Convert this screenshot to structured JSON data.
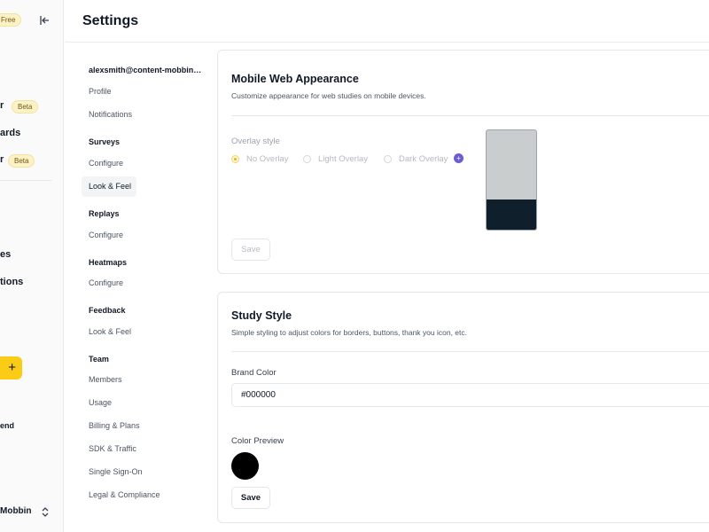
{
  "sidebar": {
    "plan_badge": "Free",
    "items": [
      {
        "label": "r",
        "badge": "Beta"
      },
      {
        "label": "ards"
      },
      {
        "label": "r",
        "badge": "Beta"
      },
      {
        "label": "es"
      },
      {
        "label": "tions"
      },
      {
        "label": "end"
      }
    ],
    "plus_label": "+",
    "account_label": "Mobbin"
  },
  "header": {
    "title": "Settings"
  },
  "settings_nav": {
    "email": "alexsmith@content-mobbin.c...",
    "account_items": [
      "Profile",
      "Notifications"
    ],
    "sections": [
      {
        "heading": "Surveys",
        "items": [
          "Configure",
          "Look & Feel"
        ]
      },
      {
        "heading": "Replays",
        "items": [
          "Configure"
        ]
      },
      {
        "heading": "Heatmaps",
        "items": [
          "Configure"
        ]
      },
      {
        "heading": "Feedback",
        "items": [
          "Look & Feel"
        ]
      },
      {
        "heading": "Team",
        "items": [
          "Members",
          "Usage",
          "Billing & Plans",
          "SDK & Traffic",
          "Single Sign-On",
          "Legal & Compliance"
        ]
      }
    ]
  },
  "mobile_card": {
    "title": "Mobile Web Appearance",
    "description": "Customize appearance for web studies on mobile devices.",
    "overlay_label": "Overlay style",
    "options": [
      "No Overlay",
      "Light Overlay",
      "Dark Overlay"
    ],
    "selected_option": "No Overlay",
    "info_icon": "+",
    "save_label": "Save"
  },
  "study_card": {
    "title": "Study Style",
    "description": "Simple styling to adjust colors for borders, buttons, thank you icon, etc.",
    "brand_label": "Brand Color",
    "brand_value": "#000000",
    "preview_label": "Color Preview",
    "save_label": "Save"
  },
  "colors": {
    "accent_yellow": "#facc15",
    "info_purple": "#6d5dd3",
    "preview_color": "#000000",
    "phone_top": "#c9cdcd",
    "phone_bottom": "#0f1f2b"
  }
}
